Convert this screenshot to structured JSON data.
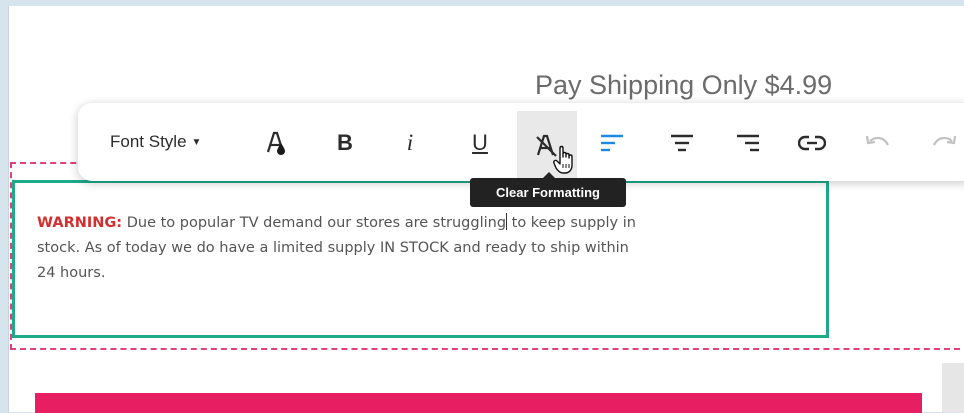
{
  "page": {
    "promo_text": "Pay Shipping Only $4.99"
  },
  "toolbar": {
    "font_style_label": "Font Style",
    "buttons": [
      {
        "name": "font-color",
        "icon": "font-color-icon"
      },
      {
        "name": "bold",
        "label": "B"
      },
      {
        "name": "italic",
        "label": "i"
      },
      {
        "name": "underline",
        "label": "U"
      },
      {
        "name": "clear-formatting",
        "icon": "clear-formatting-icon",
        "active": true
      },
      {
        "name": "align-left",
        "icon": "align-left-icon",
        "active_color": "#1e88e5"
      },
      {
        "name": "align-center",
        "icon": "align-center-icon"
      },
      {
        "name": "align-right",
        "icon": "align-right-icon"
      },
      {
        "name": "link",
        "icon": "link-icon"
      },
      {
        "name": "undo",
        "icon": "undo-icon"
      },
      {
        "name": "redo",
        "icon": "redo-icon"
      }
    ],
    "tooltip": "Clear Formatting"
  },
  "content": {
    "warning_label": "WARNING:",
    "line1_before_cursor": " Due to popular TV demand our stores are struggling",
    "line1_after_cursor": " to keep supply in",
    "line2": "stock. As of today we do have a limited supply IN STOCK and ready to ship within",
    "line3": "24 hours."
  },
  "colors": {
    "accent_teal": "#1ea98b",
    "section_pink": "#e0407e",
    "bar_pink": "#e81e63",
    "warning_red": "#d32f2f",
    "align_blue": "#1e88e5"
  }
}
